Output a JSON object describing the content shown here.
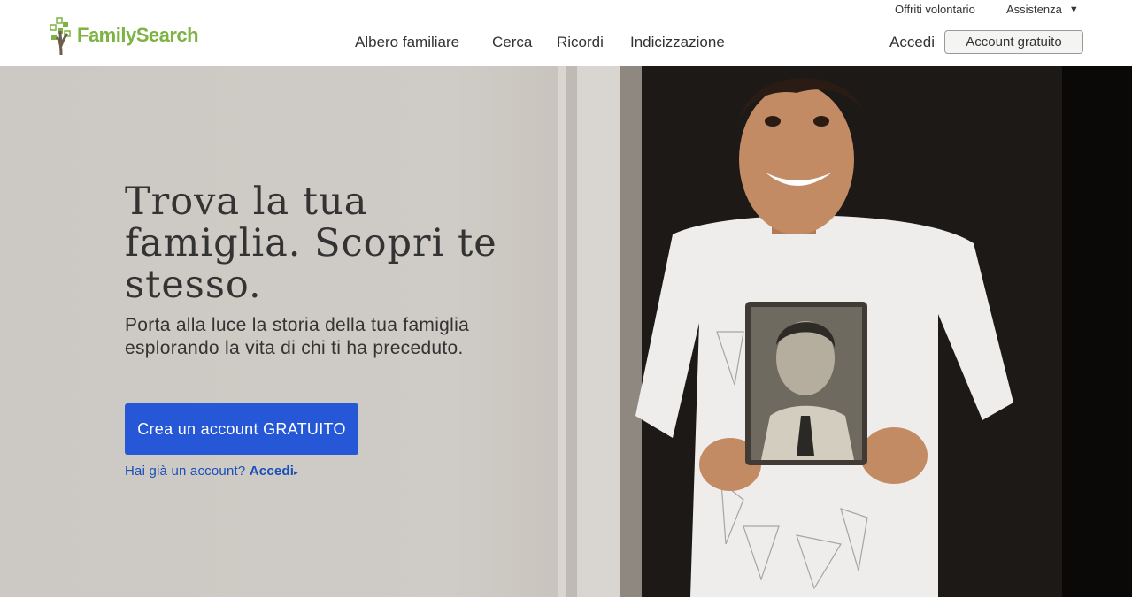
{
  "header": {
    "logo_text": "FamilySearch",
    "utility": {
      "volunteer": "Offriti volontario",
      "help": "Assistenza",
      "help_caret": "▼"
    },
    "nav": [
      {
        "label": "Albero familiare"
      },
      {
        "label": "Cerca"
      },
      {
        "label": "Ricordi"
      },
      {
        "label": "Indicizzazione"
      }
    ],
    "sign_in": "Accedi",
    "free_account": "Account gratuito"
  },
  "hero": {
    "headline": "Trova la tua famiglia. Scopri te stesso.",
    "subhead": "Porta alla luce la storia della tua famiglia esplorando la vita di chi ti ha preceduto.",
    "cta_label": "Crea un account GRATUITO",
    "have_account": "Hai già un account?",
    "have_account_signin": "Accedi",
    "arrow": "▸"
  },
  "colors": {
    "brand_green": "#7cb342",
    "cta_blue": "#2557d6",
    "link_blue": "#1a4fb8"
  },
  "icons": {
    "logo": "family-tree-icon",
    "caret": "caret-down-icon"
  }
}
